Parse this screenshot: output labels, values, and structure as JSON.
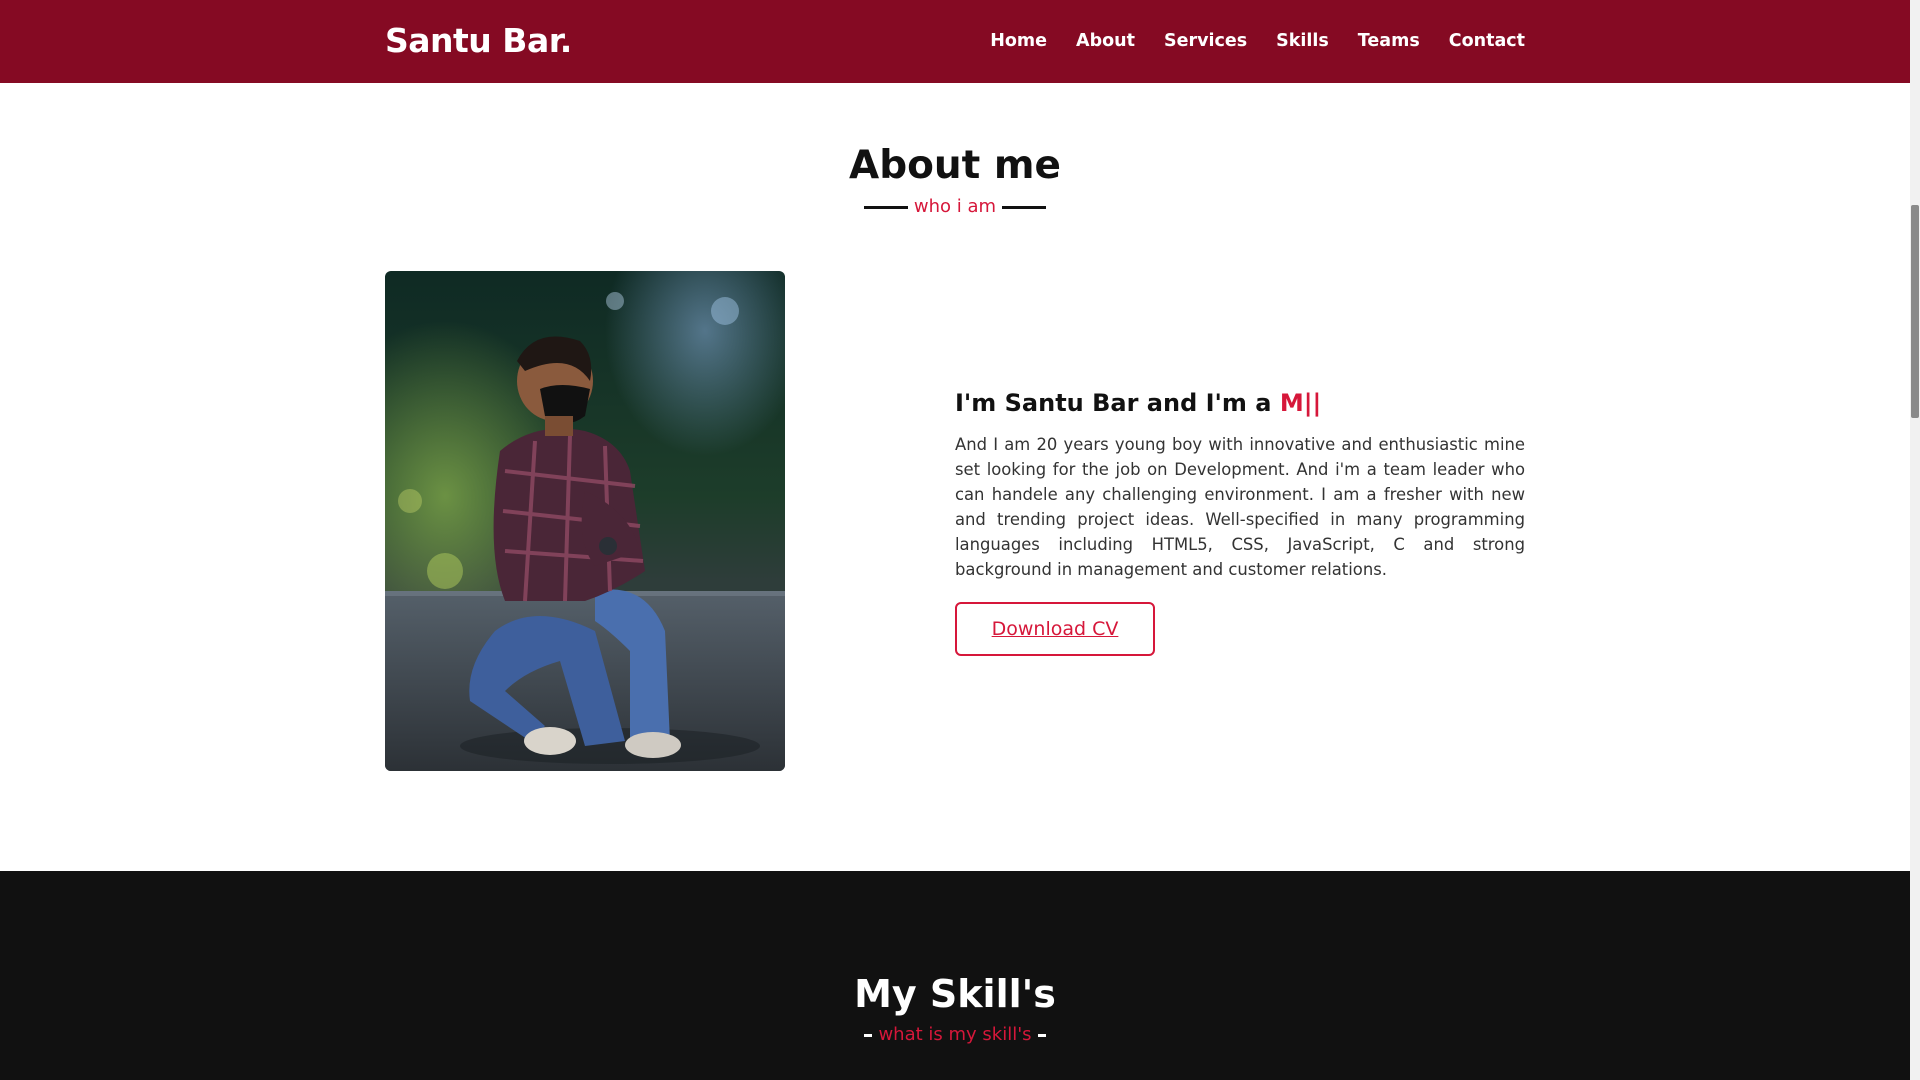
{
  "navbar": {
    "brand": "Santu Bar.",
    "items": [
      {
        "label": "Home"
      },
      {
        "label": "About"
      },
      {
        "label": "Services"
      },
      {
        "label": "Skills"
      },
      {
        "label": "Teams"
      },
      {
        "label": "Contact"
      }
    ]
  },
  "about": {
    "title": "About me",
    "subtitle": "who i am",
    "heading_prefix": "I'm Santu Bar and I'm a",
    "typed_text": "M||",
    "paragraph": "And I am 20 years young boy with innovative and enthusiastic mine set looking for the job on Development. And i'm a team leader who can handele any challenging environment. I am a fresher with new and trending project ideas. Well-specified in many programming languages including HTML5, CSS, JavaScript, C and strong background in management and customer relations.",
    "button_label": "Download CV"
  },
  "skills": {
    "title": "My Skill's",
    "subtitle": "what is my skill's"
  },
  "colors": {
    "navbar": "#850a23",
    "accent": "#d6173a",
    "dark_section": "#111111",
    "text": "#333333"
  },
  "icons": {
    "photo": "profile-photo-of-person-crouching"
  }
}
